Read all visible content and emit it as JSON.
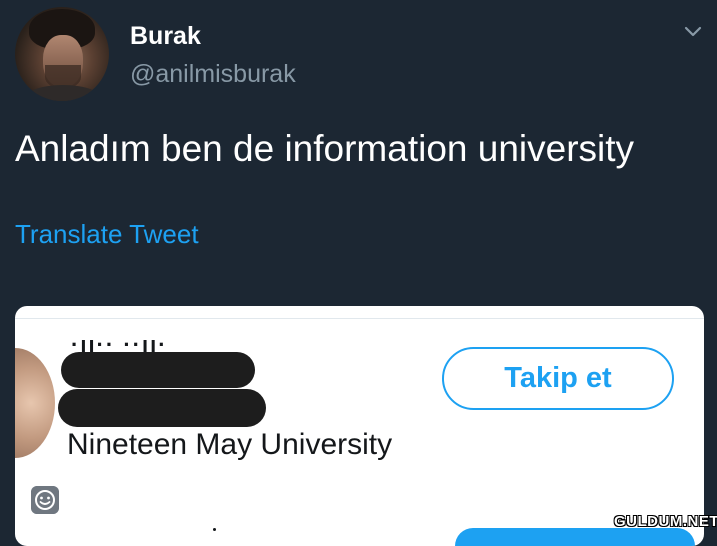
{
  "tweet": {
    "author": {
      "name": "Burak",
      "handle": "@anilmisburak"
    },
    "text": "Anladım ben de information university",
    "translate_label": "Translate Tweet"
  },
  "embedded_card": {
    "bio": "Nineteen May University",
    "follow_label": "Takip et"
  },
  "watermark": "GULDUM.NET",
  "colors": {
    "background": "#1c2733",
    "accent": "#1da1f2",
    "secondary_text": "#8899a6"
  },
  "icons": [
    "chevron-down-icon",
    "smiley-icon"
  ]
}
